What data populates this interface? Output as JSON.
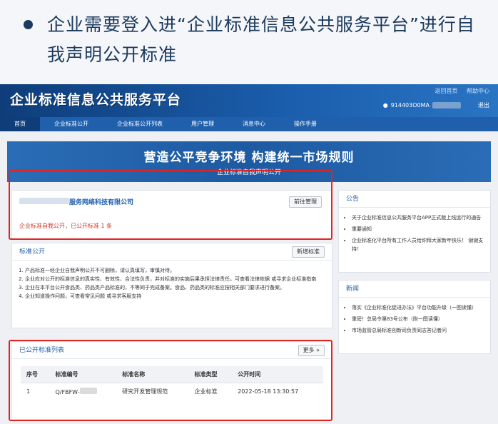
{
  "slide": {
    "bullet_text": "企业需要登入进“企业标准信息公共服务平台”进行自我声明公开标准"
  },
  "header": {
    "logo": "企业标准信息公共服务平台",
    "links": [
      "返回首页",
      "帮助中心"
    ],
    "user_id": "914403O0MA",
    "logout": "退出"
  },
  "nav": {
    "items": [
      "首页",
      "企业标准公开",
      "企业标准公开列表",
      "用户管理",
      "消息中心",
      "操作手册"
    ]
  },
  "banner": {
    "title": "营造公平竞争环境  构建统一市场规则",
    "subtitle": "企业标准自我声明公开"
  },
  "company": {
    "name": "服务网络科技有限公司",
    "button": "前往管理",
    "status": "企业标准自我公开，已公开标准 1 条"
  },
  "std_public": {
    "title": "标准公开",
    "button": "新增标准",
    "rules": [
      "产品标准一经企业自我声明公开不可删除，请认真填写，审慎对待。",
      "企业应对公开的标准信息的真实性、有效性、合法性负责，并对标准的实施后果承担法律责任。可查看法律依据 或寻求企业标准指南",
      "企业在本平台公开食品类、药品类产品标准的，不等同于完成备案。食品、药品类的标准应按相关部门要求进行备案。",
      "企业知道操作问题，可查看常见问题 或寻求客服支持"
    ]
  },
  "list": {
    "title": "已公开标准列表",
    "more": "更多 »",
    "headers": [
      "序号",
      "标准编号",
      "标准名称",
      "标准类型",
      "公开时间"
    ],
    "rows": [
      [
        "1",
        "Q/FBFW-",
        "研究开发管理规范",
        "企业标准",
        "2022-05-18 13:30:57"
      ]
    ]
  },
  "announce": {
    "title": "公告",
    "items": [
      "关于企业标准信息公共服务平台APP正式版上线运行的通告",
      "重要通知",
      "企业标准化平台所有工作人员给你拜大家新年快乐！ 谢谢支持！"
    ]
  },
  "news": {
    "title": "新闻",
    "items": [
      "落实《企业标准化促进办法》平台功能升级（一图读懂）",
      "重磅！总局令第83号公布（附一图读懂）",
      "市场监管总局标准创新司负责同志答记者问"
    ]
  }
}
